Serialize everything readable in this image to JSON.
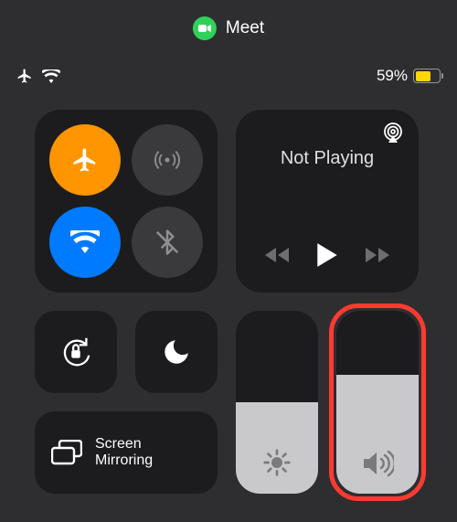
{
  "pill": {
    "app": "Meet"
  },
  "status": {
    "battery_pct": "59%",
    "battery_level": 59
  },
  "connectivity": {
    "airplane": {
      "active": true
    },
    "cellular": {
      "active": false
    },
    "wifi": {
      "active": true
    },
    "bluetooth": {
      "active": false
    }
  },
  "media": {
    "title": "Not Playing"
  },
  "toggles": {
    "orientation_lock": true,
    "dnd": false
  },
  "mirror": {
    "label": "Screen Mirroring"
  },
  "sliders": {
    "brightness": 50,
    "volume": 65
  }
}
